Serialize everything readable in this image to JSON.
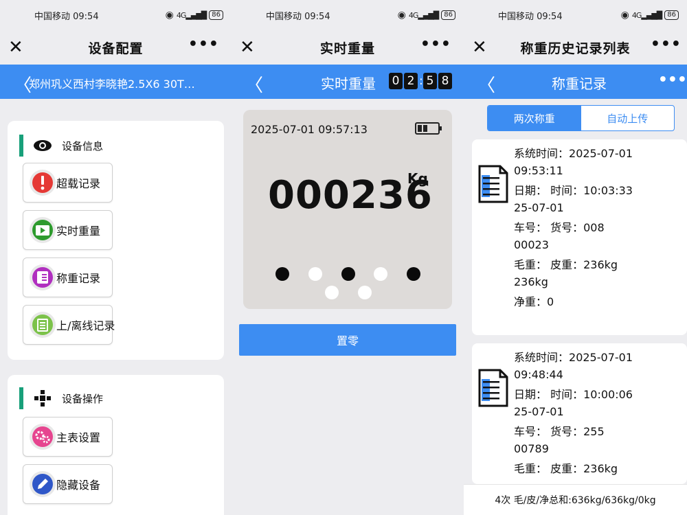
{
  "status_bar": {
    "carrier_time": "中国移动 09:54",
    "battery": "86"
  },
  "panels": [
    {
      "title": "设备配置",
      "device_name": "郑州巩义西村李晓艳2.5X6 30T…",
      "section1": {
        "title": "设备信息",
        "items": [
          {
            "label": "超载记录",
            "icon": "overload-alert-icon",
            "color": "#e53935"
          },
          {
            "label": "实时重量",
            "icon": "realtime-tv-icon",
            "color": "#2e9b2e"
          },
          {
            "label": "称重记录",
            "icon": "record-list-icon",
            "color": "#b02fbf"
          },
          {
            "label": "上/离线记录",
            "icon": "online-log-icon",
            "color": "#7cc24a"
          }
        ]
      },
      "section2": {
        "title": "设备操作",
        "items": [
          {
            "label": "主表设置",
            "icon": "settings-gear-icon",
            "color": "#e6458f"
          },
          {
            "label": "隐藏设备",
            "icon": "hide-pencil-icon",
            "color": "#2f57c8"
          }
        ]
      }
    },
    {
      "title": "实时重量",
      "countdown": [
        "0",
        "2",
        "5",
        "8"
      ],
      "timestamp": "2025-07-01 09:57:13",
      "weight": "000236",
      "unit": "Kg",
      "zero_button": "置零"
    },
    {
      "title": "称重历史记录列表",
      "subtitle": "称重记录",
      "tabs": [
        "两次称重",
        "自动上传"
      ],
      "records": [
        {
          "system_time_label": "系统时间：",
          "system_time": "2025-07-01 09:53:11",
          "date_line": "日期：  时间：10:03:33",
          "date": "25-07-01",
          "vehicle_line": "车号：  货号：008",
          "vehicle": "00023",
          "gross_line": "毛重：  皮重：236kg",
          "gross": "236kg",
          "net": "净重：0"
        },
        {
          "system_time_label": "系统时间：",
          "system_time": "2025-07-01 09:48:44",
          "date_line": "日期：  时间：10:00:06",
          "date": "25-07-01",
          "vehicle_line": "车号：  货号：255",
          "vehicle": "00789",
          "gross_line": "毛重：  皮重：236kg"
        }
      ],
      "summary": "4次  毛/皮/净总和:636kg/636kg/0kg"
    }
  ]
}
